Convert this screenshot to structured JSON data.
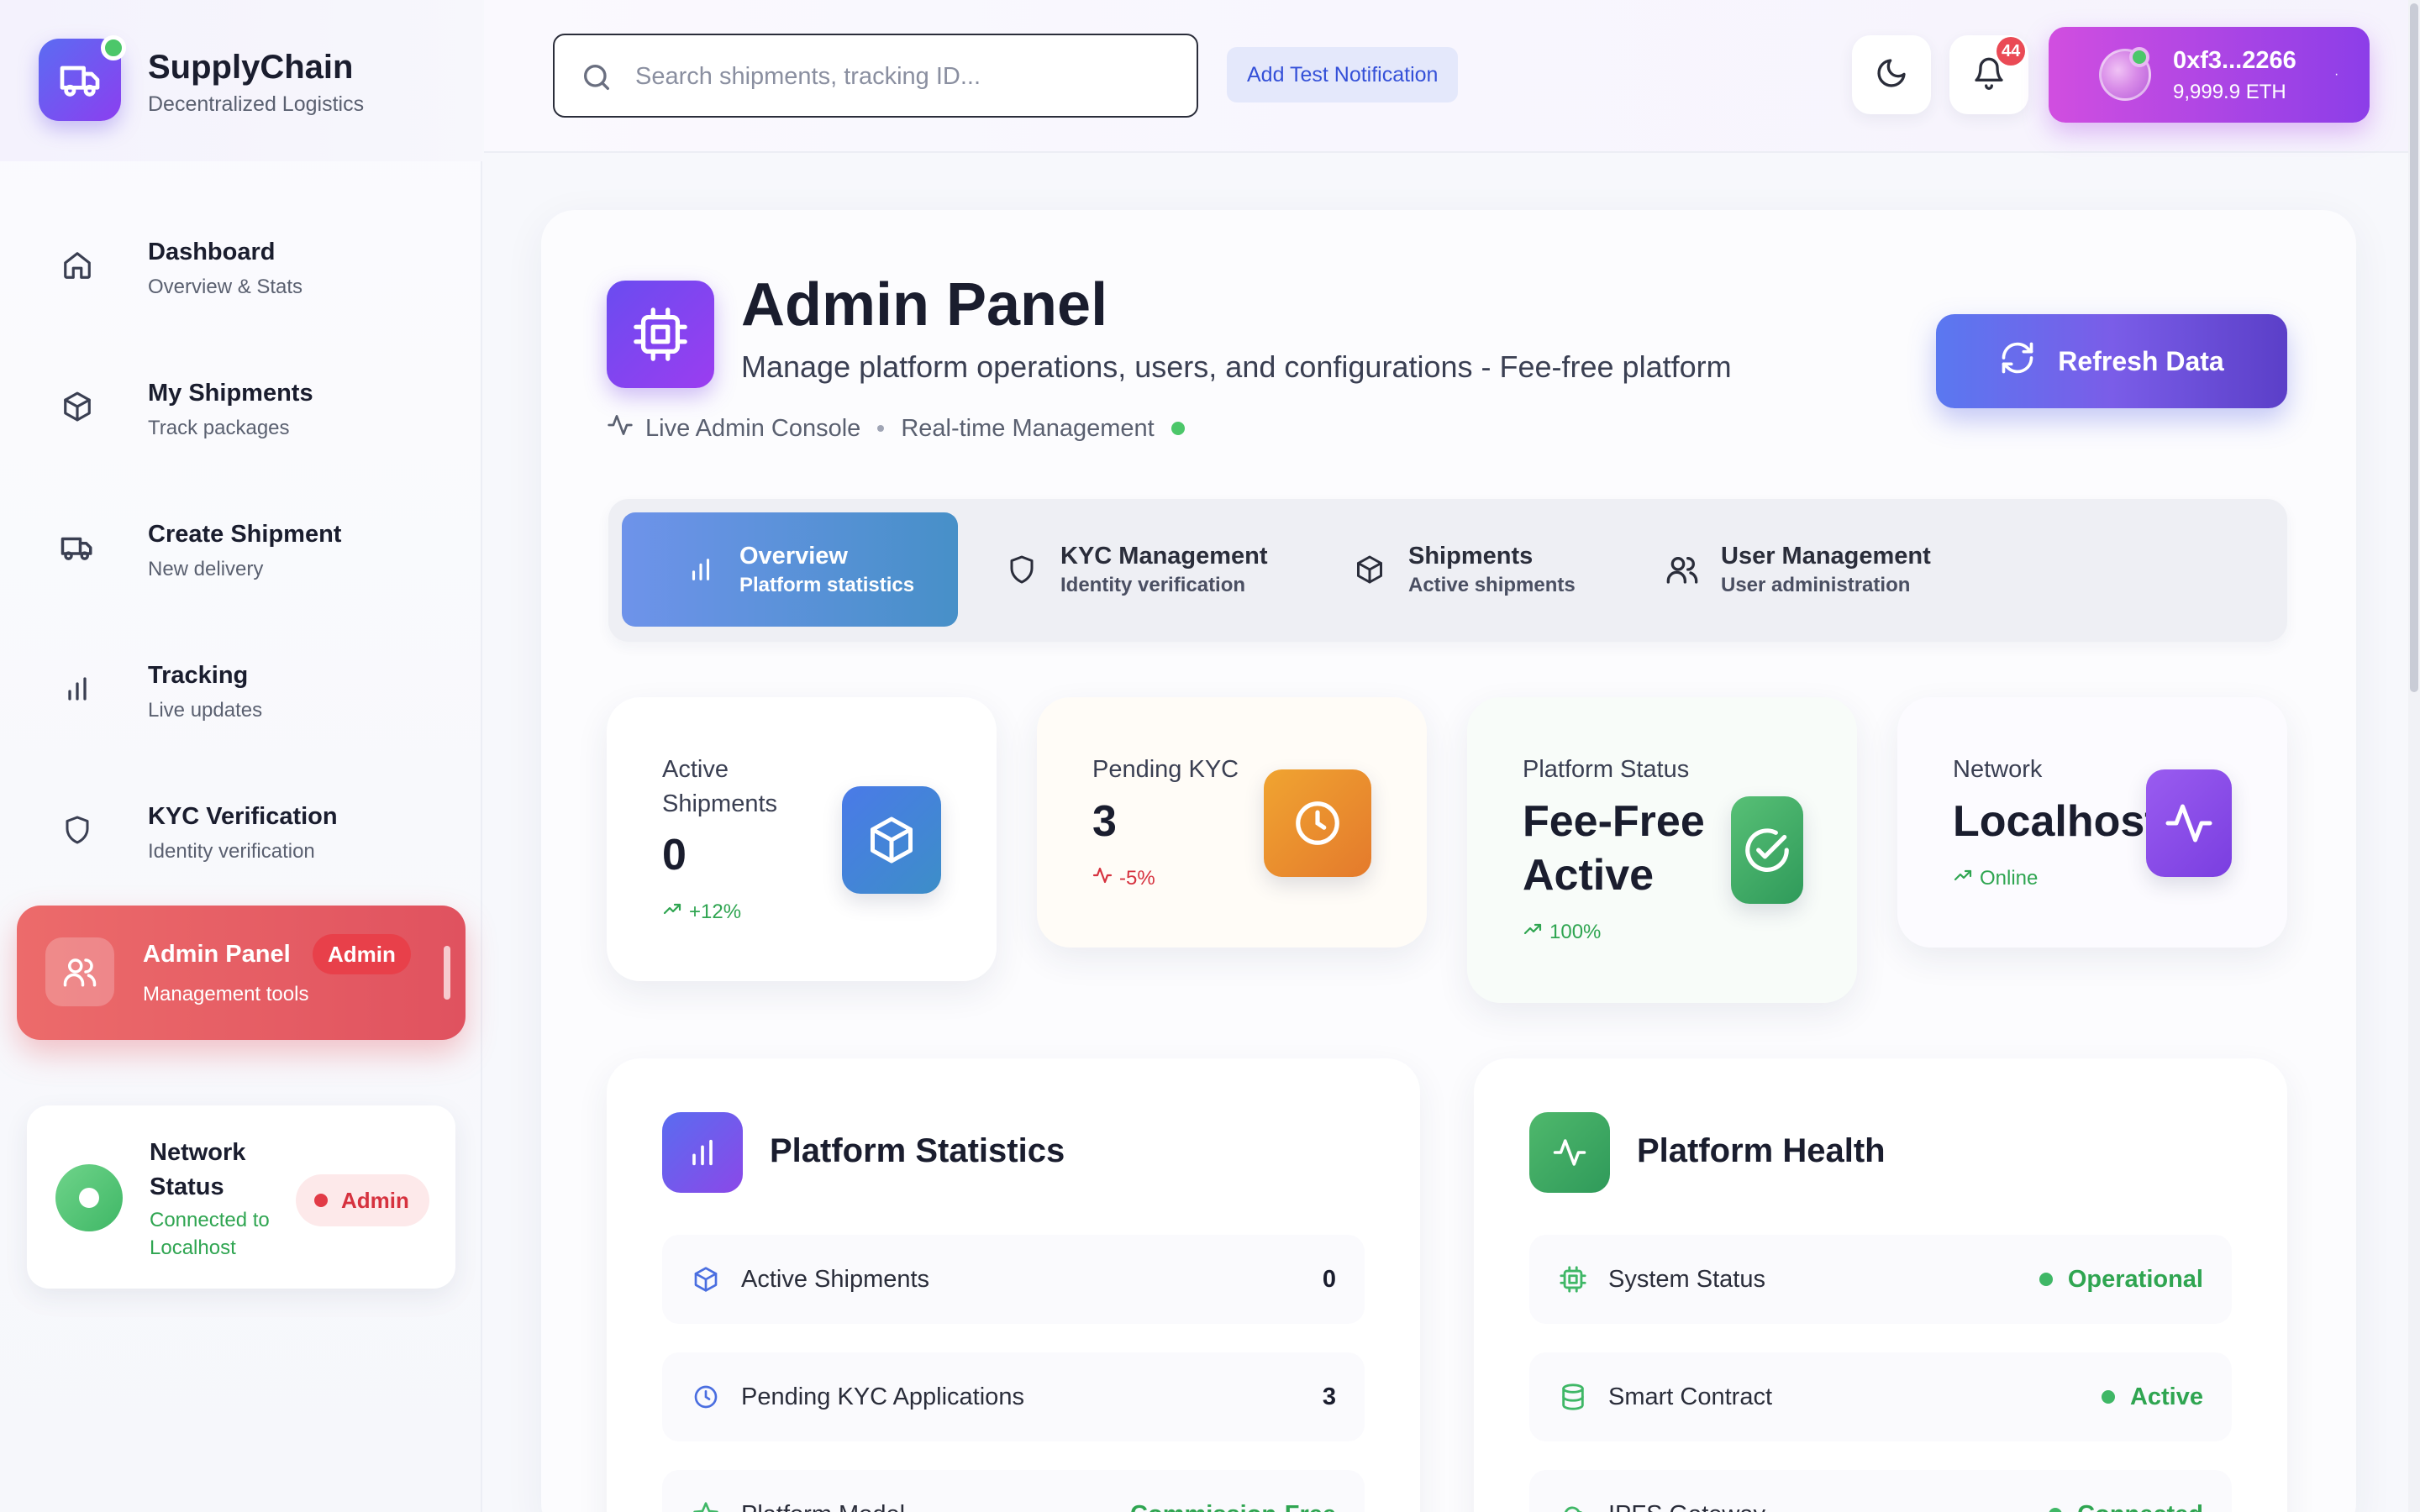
{
  "brand": {
    "title": "SupplyChain",
    "subtitle": "Decentralized Logistics"
  },
  "sidebar": {
    "items": [
      {
        "label": "Dashboard",
        "sub": "Overview & Stats",
        "icon": "home-icon"
      },
      {
        "label": "My Shipments",
        "sub": "Track packages",
        "icon": "package-icon"
      },
      {
        "label": "Create Shipment",
        "sub": "New delivery",
        "icon": "truck-icon"
      },
      {
        "label": "Tracking",
        "sub": "Live updates",
        "icon": "bar-chart-icon"
      },
      {
        "label": "KYC Verification",
        "sub": "Identity verification",
        "icon": "shield-icon"
      },
      {
        "label": "Admin Panel",
        "sub": "Management tools",
        "icon": "users-icon",
        "badge": "Admin",
        "active": true
      }
    ],
    "network": {
      "title": "Network Status",
      "status": "Connected to Localhost",
      "badge": "Admin"
    }
  },
  "topbar": {
    "search_placeholder": "Search shipments, tracking ID...",
    "test_button": "Add Test Notification",
    "notification_count": "44",
    "wallet": {
      "address": "0xf3...2266",
      "balance": "9,999.9 ETH"
    }
  },
  "header": {
    "title": "Admin Panel",
    "subtitle": "Manage platform operations, users, and configurations - Fee-free platform",
    "meta1": "Live Admin Console",
    "meta2": "Real-time Management",
    "refresh": "Refresh Data"
  },
  "tabs": [
    {
      "label": "Overview",
      "sub": "Platform statistics",
      "active": true
    },
    {
      "label": "KYC Management",
      "sub": "Identity verification"
    },
    {
      "label": "Shipments",
      "sub": "Active shipments"
    },
    {
      "label": "User Management",
      "sub": "User administration"
    }
  ],
  "stats": {
    "active": {
      "label": "Active Shipments",
      "value": "0",
      "trend": "+12%"
    },
    "kyc": {
      "label": "Pending KYC",
      "value": "3",
      "trend": "-5%"
    },
    "platform": {
      "label": "Platform Status",
      "value": "Fee-Free Active",
      "trend": "100%"
    },
    "network": {
      "label": "Network",
      "value": "Localhost",
      "trend": "Online"
    }
  },
  "platform_stats": {
    "title": "Platform Statistics",
    "rows": [
      {
        "label": "Active Shipments",
        "value": "0"
      },
      {
        "label": "Pending KYC Applications",
        "value": "3"
      },
      {
        "label": "Platform Model",
        "value": "Commission-Free"
      }
    ]
  },
  "platform_health": {
    "title": "Platform Health",
    "rows": [
      {
        "label": "System Status",
        "value": "Operational"
      },
      {
        "label": "Smart Contract",
        "value": "Active"
      },
      {
        "label": "IPFS Gateway",
        "value": "Connected"
      }
    ]
  },
  "colors": {
    "accent": "#6a4cf0",
    "admin_red": "#e0525f",
    "success": "#2fa551",
    "warning": "#e88a2e",
    "info": "#4a8ad8"
  }
}
